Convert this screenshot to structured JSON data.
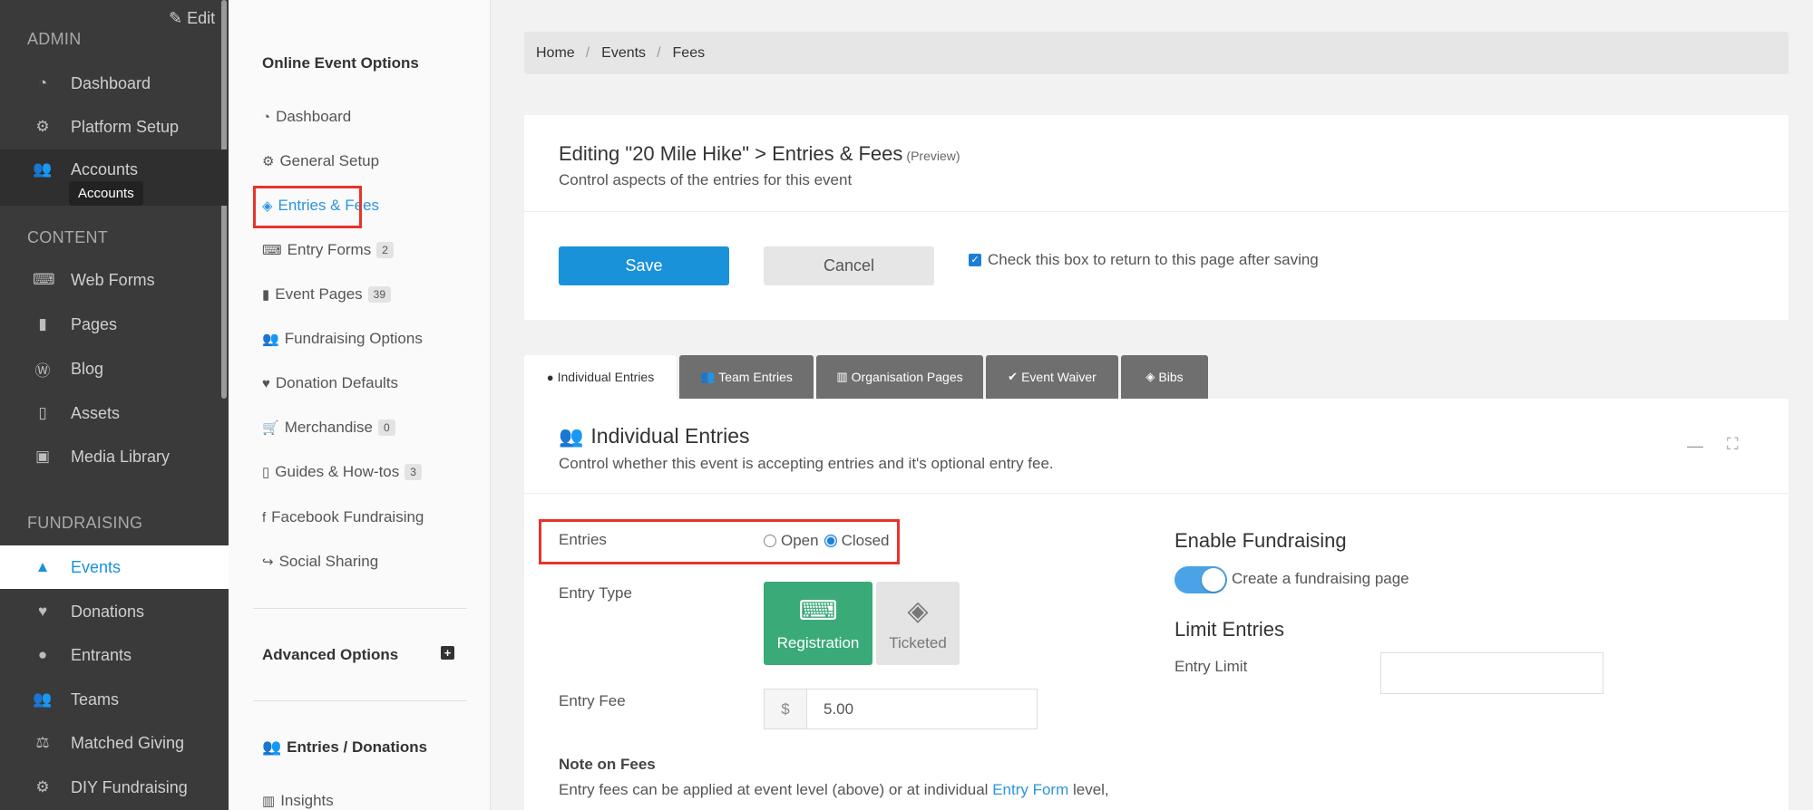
{
  "admin_sidebar": {
    "edit_label": "Edit",
    "tooltip": "Accounts",
    "sections": [
      {
        "heading": "ADMIN",
        "items": [
          {
            "label": "Dashboard",
            "icon": "tachometer-icon"
          },
          {
            "label": "Platform Setup",
            "icon": "cogs-icon"
          },
          {
            "label": "Accounts",
            "icon": "users-icon"
          }
        ]
      },
      {
        "heading": "CONTENT",
        "items": [
          {
            "label": "Web Forms",
            "icon": "keyboard-icon"
          },
          {
            "label": "Pages",
            "icon": "file-icon"
          },
          {
            "label": "Blog",
            "icon": "wordpress-icon"
          },
          {
            "label": "Assets",
            "icon": "file-pdf-icon"
          },
          {
            "label": "Media Library",
            "icon": "image-icon"
          }
        ]
      },
      {
        "heading": "FUNDRAISING",
        "items": [
          {
            "label": "Events",
            "icon": "road-icon"
          },
          {
            "label": "Donations",
            "icon": "heart-icon"
          },
          {
            "label": "Entrants",
            "icon": "user-icon"
          },
          {
            "label": "Teams",
            "icon": "users-icon"
          },
          {
            "label": "Matched Giving",
            "icon": "balance-scale-icon"
          },
          {
            "label": "DIY Fundraising",
            "icon": "cog-icon"
          }
        ]
      }
    ]
  },
  "event_options": {
    "title": "Online Event Options",
    "items": [
      {
        "label": "Dashboard",
        "icon": "tachometer-icon",
        "badge": null
      },
      {
        "label": "General Setup",
        "icon": "cog-icon",
        "badge": null
      },
      {
        "label": "Entries & Fees",
        "icon": "tag-icon",
        "badge": null
      },
      {
        "label": "Entry Forms",
        "icon": "keyboard-icon",
        "badge": "2"
      },
      {
        "label": "Event Pages",
        "icon": "file-icon",
        "badge": "39"
      },
      {
        "label": "Fundraising Options",
        "icon": "users-icon",
        "badge": null
      },
      {
        "label": "Donation Defaults",
        "icon": "heart-icon",
        "badge": null
      },
      {
        "label": "Merchandise",
        "icon": "cart-icon",
        "badge": "0"
      },
      {
        "label": "Guides & How-tos",
        "icon": "file-pdf-icon",
        "badge": "3"
      },
      {
        "label": "Facebook Fundraising",
        "icon": "facebook-icon",
        "badge": null
      },
      {
        "label": "Social Sharing",
        "icon": "share-icon",
        "badge": null
      }
    ],
    "advanced_title": "Advanced Options",
    "entries_donations_title": "Entries / Donations",
    "insights_label": "Insights"
  },
  "breadcrumb": [
    "Home",
    "Events",
    "Fees"
  ],
  "header_card": {
    "title": "Editing \"20 Mile Hike\" > Entries & Fees",
    "title_note": "(Preview)",
    "subtitle": "Control aspects of the entries for this event",
    "save_label": "Save",
    "cancel_label": "Cancel",
    "return_checkbox_label": "Check this box to return to this page after saving",
    "return_checked": true
  },
  "tabs": [
    {
      "label": "Individual Entries",
      "icon": "user-icon",
      "active": true
    },
    {
      "label": "Team Entries",
      "icon": "users-icon",
      "active": false
    },
    {
      "label": "Organisation Pages",
      "icon": "building-icon",
      "active": false
    },
    {
      "label": "Event Waiver",
      "icon": "check-icon",
      "active": false
    },
    {
      "label": "Bibs",
      "icon": "tag-icon",
      "active": false
    }
  ],
  "panel": {
    "title": "Individual Entries",
    "subtitle": "Control whether this event is accepting entries and it's optional entry fee.",
    "entries_label": "Entries",
    "entries_options": [
      "Open",
      "Closed"
    ],
    "entries_selected": "Closed",
    "entry_type_label": "Entry Type",
    "entry_types": [
      "Registration",
      "Ticketed"
    ],
    "entry_type_selected": "Registration",
    "entry_fee_label": "Entry Fee",
    "currency_symbol": "$",
    "entry_fee_value": "5.00",
    "note_title": "Note on Fees",
    "note_text_before": "Entry fees can be applied at event level (above) or at individual ",
    "note_link": "Entry Form",
    "note_text_after": " level,",
    "enable_fundraising_title": "Enable Fundraising",
    "fundraising_toggle_label": "Create a fundraising page",
    "fundraising_enabled": true,
    "limit_entries_title": "Limit Entries",
    "entry_limit_label": "Entry Limit",
    "entry_limit_value": ""
  },
  "colors": {
    "accent": "#1a92d9",
    "sidebar_bg": "#3a3a3a",
    "selected_type": "#3aaa78",
    "highlight_box": "#e8342a"
  }
}
